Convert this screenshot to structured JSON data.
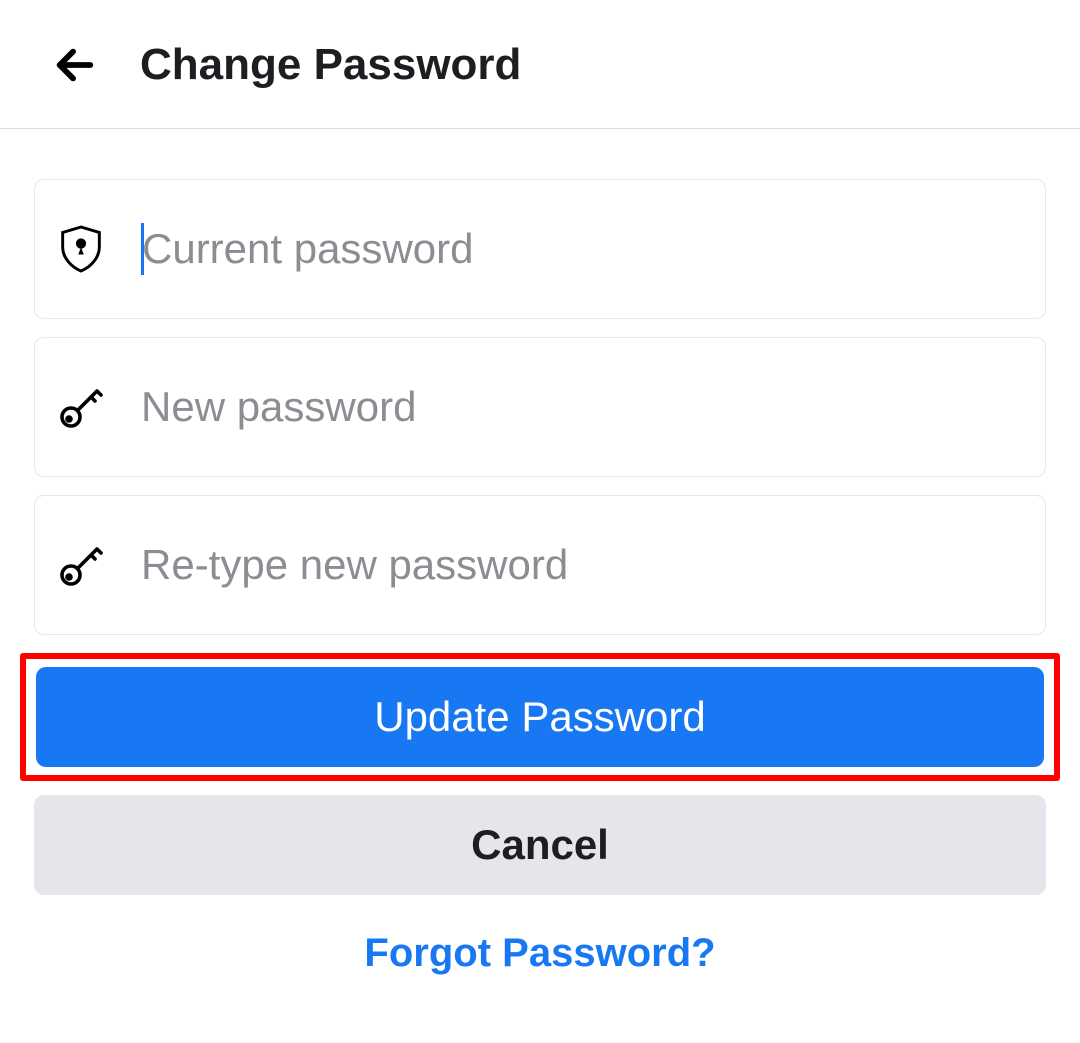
{
  "header": {
    "title": "Change Password"
  },
  "fields": {
    "current": {
      "placeholder": "Current password"
    },
    "new": {
      "placeholder": "New password"
    },
    "retype": {
      "placeholder": "Re-type new password"
    }
  },
  "buttons": {
    "update": "Update Password",
    "cancel": "Cancel"
  },
  "links": {
    "forgot": "Forgot Password?"
  }
}
